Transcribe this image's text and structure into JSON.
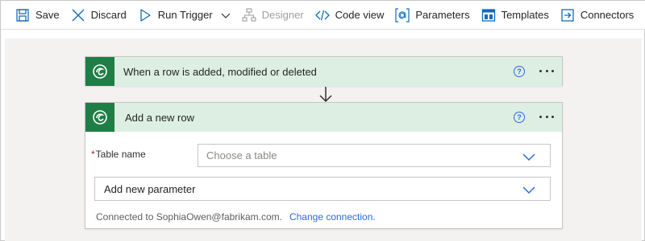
{
  "toolbar": {
    "save": "Save",
    "discard": "Discard",
    "run_trigger": "Run Trigger",
    "designer": "Designer",
    "code_view": "Code view",
    "parameters": "Parameters",
    "templates": "Templates",
    "connectors": "Connectors"
  },
  "trigger_card": {
    "title": "When a row is added, modified or deleted",
    "help": "?"
  },
  "action_card": {
    "title": "Add a new row",
    "help": "?",
    "table_name_label": "Table name",
    "required_marker": "*",
    "table_placeholder": "Choose a table",
    "add_parameter": "Add new parameter",
    "connected_text": "Connected to SophiaOwen@fabrikam.com.",
    "change_connection": "Change connection."
  },
  "colors": {
    "card_header": "#ddefe3",
    "logo_bg": "#1e7e45",
    "accent": "#2b6ae0",
    "toolbar_icon": "#0f6cbd"
  }
}
